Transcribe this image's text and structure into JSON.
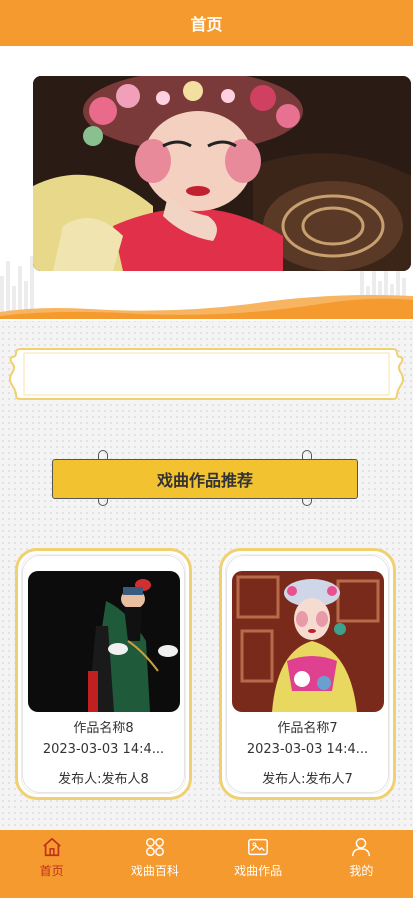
{
  "header": {
    "title": "首页"
  },
  "colors": {
    "primary": "#f59a2e",
    "accent_yellow": "#f2c230",
    "active_tab": "#c0301d"
  },
  "banner": {
    "icon": "opera-performer-image"
  },
  "section": {
    "title": "戏曲作品推荐"
  },
  "cards": [
    {
      "name": "作品名称8",
      "time": "2023-03-03 14:4...",
      "publisher": "发布人:发布人8",
      "image": "opera-performer-black-robe"
    },
    {
      "name": "作品名称7",
      "time": "2023-03-03 14:4...",
      "publisher": "发布人:发布人7",
      "image": "opera-performer-headdress"
    }
  ],
  "tabbar": {
    "items": [
      {
        "label": "首页",
        "icon": "home-icon",
        "active": true
      },
      {
        "label": "戏曲百科",
        "icon": "grid-icon",
        "active": false
      },
      {
        "label": "戏曲作品",
        "icon": "picture-icon",
        "active": false
      },
      {
        "label": "我的",
        "icon": "user-icon",
        "active": false
      }
    ]
  }
}
